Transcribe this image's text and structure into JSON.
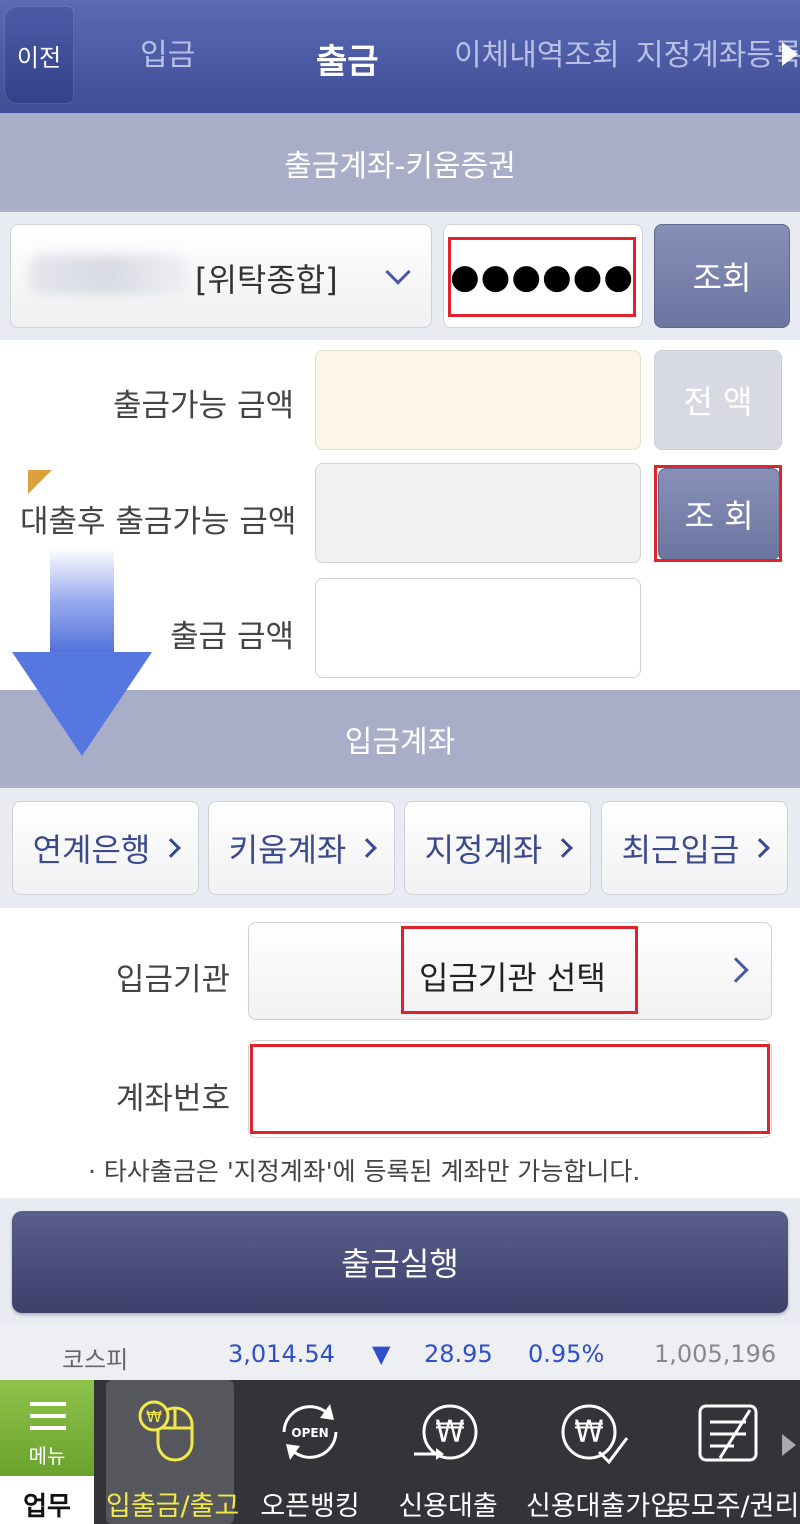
{
  "nav": {
    "back_label": "이전",
    "tabs": [
      "입금",
      "출금",
      "이체내역조회",
      "지정계좌등록"
    ],
    "active_tab": "출금"
  },
  "withdraw_section": {
    "title": "출금계좌-키움증권",
    "account_type": "[위탁종합]",
    "password_mask": "●●●●●●",
    "query_button": "조회"
  },
  "amounts": {
    "available_label": "출금가능 금액",
    "full_amount_button": "전 액",
    "after_loan_label": "대출후 출금가능 금액",
    "after_loan_query_button": "조 회",
    "amount_label": "출금 금액"
  },
  "deposit_section": {
    "title": "입금계좌",
    "tabs": [
      "연계은행",
      "키움계좌",
      "지정계좌",
      "최근입금"
    ],
    "institution_label": "입금기관",
    "institution_placeholder": "입금기관 선택",
    "account_number_label": "계좌번호",
    "notice": "· 타사출금은 '지정계좌'에 등록된 계좌만 가능합니다."
  },
  "execute_button": "출금실행",
  "ticker": {
    "name": "코스피",
    "value": "3,014.54",
    "direction_symbol": "▼",
    "change": "28.95",
    "change_pct": "0.95%",
    "volume": "1,005,196"
  },
  "bottom_bar": {
    "menu_label": "메뉴",
    "work_label": "업무",
    "items": [
      {
        "label": "입출금/출고",
        "icon": "mouse-won-icon"
      },
      {
        "label": "오픈뱅킹",
        "icon": "open-refresh-icon",
        "icon_text": "OPEN"
      },
      {
        "label": "신용대출",
        "icon": "won-arrow-icon"
      },
      {
        "label": "신용대출가입",
        "icon": "won-check-icon"
      },
      {
        "label": "공모주/권리",
        "icon": "document-edit-icon"
      }
    ],
    "active_index": 0
  },
  "colors": {
    "nav_bg": "#3f4d96",
    "section_bg": "#a9aec8",
    "highlight_red": "#e0222a",
    "ticker_blue": "#2f4fc8",
    "active_yellow": "#f2e948",
    "menu_green": "#7ab13a"
  }
}
